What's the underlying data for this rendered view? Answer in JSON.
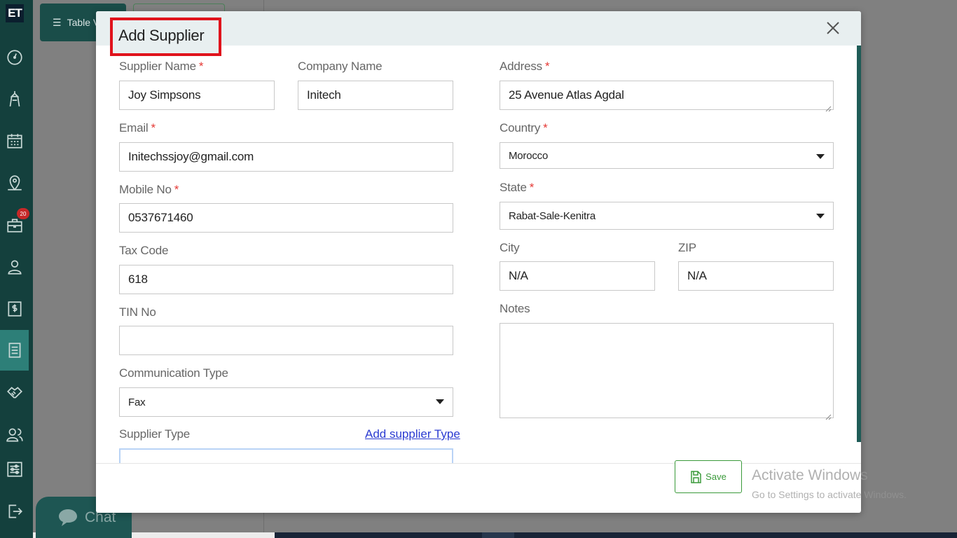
{
  "sidebar": {
    "logo": "ET",
    "badge_count": "20",
    "icons": [
      "dashboard-icon",
      "diamond-icon",
      "calendar-icon",
      "map-pin-icon",
      "briefcase-icon",
      "user-icon",
      "dollar-icon",
      "list-icon",
      "handshake-icon",
      "users-icon",
      "settings-sliders-icon",
      "logout-icon"
    ]
  },
  "background": {
    "table_view_label": "Table V",
    "chat_label": "Chat"
  },
  "modal": {
    "title": "Add Supplier",
    "fields": {
      "supplier_name": {
        "label": "Supplier Name",
        "required": "*",
        "value": "Joy Simpsons"
      },
      "company_name": {
        "label": "Company Name",
        "value": "Initech"
      },
      "email": {
        "label": "Email",
        "required": "*",
        "value": "Initechssjoy@gmail.com"
      },
      "mobile_no": {
        "label": "Mobile No",
        "required": "*",
        "value": "0537671460"
      },
      "tax_code": {
        "label": "Tax Code",
        "value": "618"
      },
      "tin_no": {
        "label": "TIN No",
        "value": ""
      },
      "communication_type": {
        "label": "Communication Type",
        "value": "Fax"
      },
      "supplier_type": {
        "label": "Supplier Type",
        "value": ""
      },
      "address": {
        "label": "Address",
        "required": "*",
        "value": "25 Avenue Atlas Agdal"
      },
      "country": {
        "label": "Country",
        "required": "*",
        "value": "Morocco"
      },
      "state": {
        "label": "State",
        "required": "*",
        "value": "Rabat-Sale-Kenitra"
      },
      "city": {
        "label": "City",
        "value": "N/A"
      },
      "zip": {
        "label": "ZIP",
        "value": "N/A"
      },
      "notes": {
        "label": "Notes",
        "value": ""
      }
    },
    "add_supplier_type_link": "Add supplier Type",
    "save_label": "Save"
  },
  "os_watermark": {
    "line1": "Activate Windows",
    "line2": "Go to Settings to activate Windows."
  }
}
